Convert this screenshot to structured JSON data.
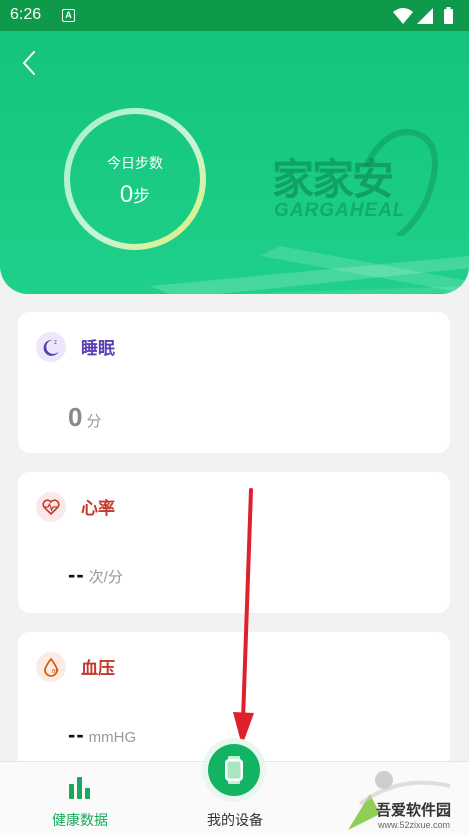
{
  "status_bar": {
    "time": "6:26",
    "notification_letter": "A"
  },
  "header": {
    "steps_label": "今日步数",
    "steps_value": "0",
    "steps_unit": "步",
    "brand_cn": "家家安",
    "brand_en": "GARGAHEAL",
    "colors": {
      "primary": "#14c47a",
      "ring_start": "#c9f7dc",
      "ring_end": "#e8f06a"
    }
  },
  "cards": [
    {
      "id": "sleep",
      "title": "睡眠",
      "value": "0",
      "unit": "分",
      "title_color": "#5b3fb0",
      "icon": "moon-icon"
    },
    {
      "id": "heart",
      "title": "心率",
      "value": "--",
      "unit": "次/分",
      "title_color": "#c0392b",
      "icon": "heart-pulse-icon"
    },
    {
      "id": "pressure",
      "title": "血压",
      "value": "--",
      "unit": "mmHG",
      "title_color": "#c0392b",
      "icon": "blood-drop-icon"
    }
  ],
  "bottom_nav": {
    "items": [
      {
        "label": "健康数据",
        "icon": "bar-chart-icon",
        "active": true
      },
      {
        "label": "我的设备",
        "icon": "watch-icon",
        "active": false
      }
    ]
  },
  "watermark": {
    "title": "吾爱软件园",
    "url": "www.52zixue.com"
  }
}
